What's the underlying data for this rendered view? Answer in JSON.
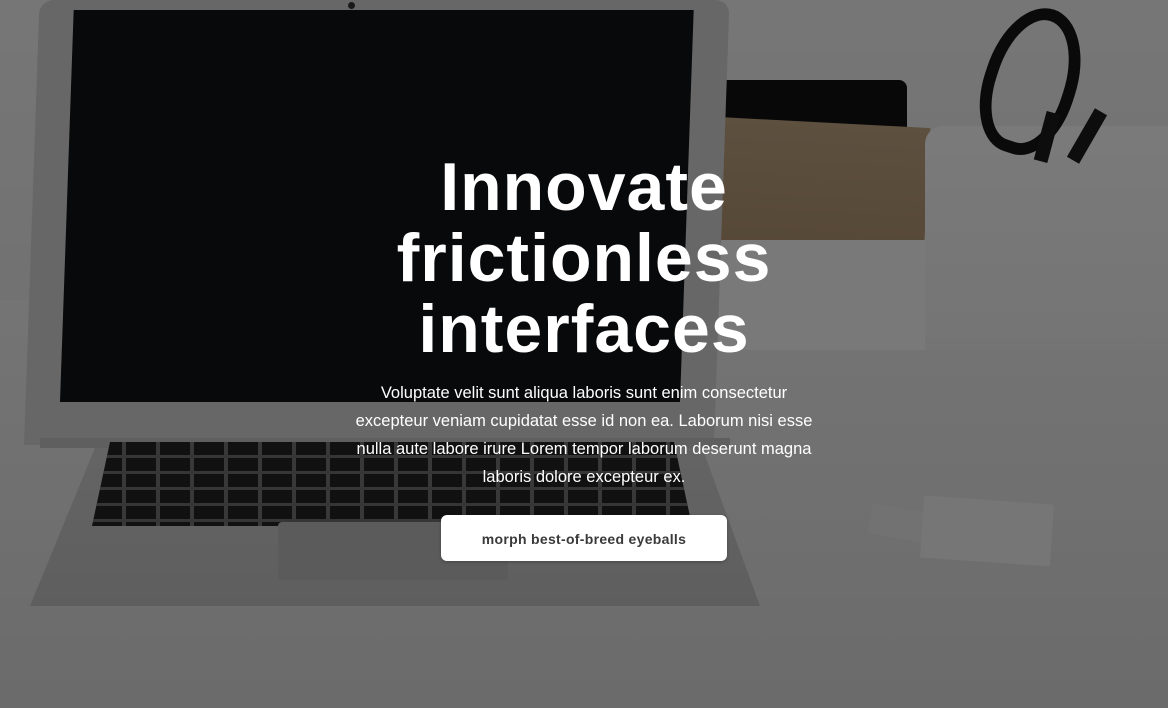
{
  "hero": {
    "title": "Innovate frictionless interfaces",
    "description": "Voluptate velit sunt aliqua laboris sunt enim consectetur excepteur veniam cupidatat esse id non ea. Laborum nisi esse nulla aute labore irure Lorem tempor laborum deserunt magna laboris dolore excepteur ex.",
    "cta_label": "morph best-of-breed eyeballs"
  },
  "colors": {
    "overlay": "#000000",
    "text": "#ffffff",
    "button_bg": "#ffffff",
    "button_text": "#3a3a3a"
  }
}
